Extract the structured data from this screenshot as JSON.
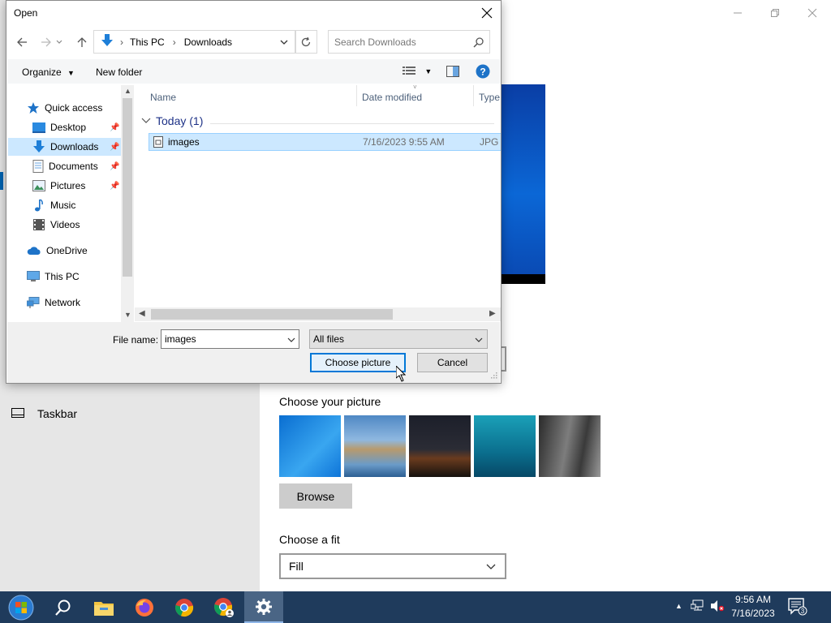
{
  "settings": {
    "taskbar_label": "Taskbar",
    "choose_picture_heading": "Choose your picture",
    "browse_label": "Browse",
    "choose_fit_heading": "Choose a fit",
    "fit_value": "Fill"
  },
  "dialog": {
    "title": "Open",
    "address": {
      "segments": [
        "This PC",
        "Downloads"
      ]
    },
    "search_placeholder": "Search Downloads",
    "toolbar": {
      "organize": "Organize",
      "new_folder": "New folder"
    },
    "sidebar": {
      "items": [
        {
          "label": "Quick access",
          "icon": "star-icon"
        },
        {
          "label": "Desktop",
          "icon": "desktop-icon",
          "pinned": true
        },
        {
          "label": "Downloads",
          "icon": "download-arrow-icon",
          "pinned": true,
          "selected": true
        },
        {
          "label": "Documents",
          "icon": "documents-icon",
          "pinned": true
        },
        {
          "label": "Pictures",
          "icon": "pictures-icon",
          "pinned": true
        },
        {
          "label": "Music",
          "icon": "music-icon"
        },
        {
          "label": "Videos",
          "icon": "videos-icon"
        },
        {
          "label": "OneDrive",
          "icon": "cloud-icon"
        },
        {
          "label": "This PC",
          "icon": "computer-icon"
        },
        {
          "label": "Network",
          "icon": "network-icon"
        }
      ]
    },
    "columns": [
      "Name",
      "Date modified",
      "Type"
    ],
    "group_label": "Today (1)",
    "files": [
      {
        "name": "images",
        "date": "7/16/2023 9:55 AM",
        "type": "JPG F"
      }
    ],
    "file_name_label": "File name:",
    "file_name_value": "images",
    "file_type_value": "All files",
    "choose_button": "Choose picture",
    "cancel_button": "Cancel"
  },
  "taskbar": {
    "time": "9:56 AM",
    "date": "7/16/2023",
    "notification_count": "3"
  },
  "colors": {
    "accent": "#0078d7",
    "selection": "#cce8ff",
    "taskbar": "#1f3b5c"
  }
}
